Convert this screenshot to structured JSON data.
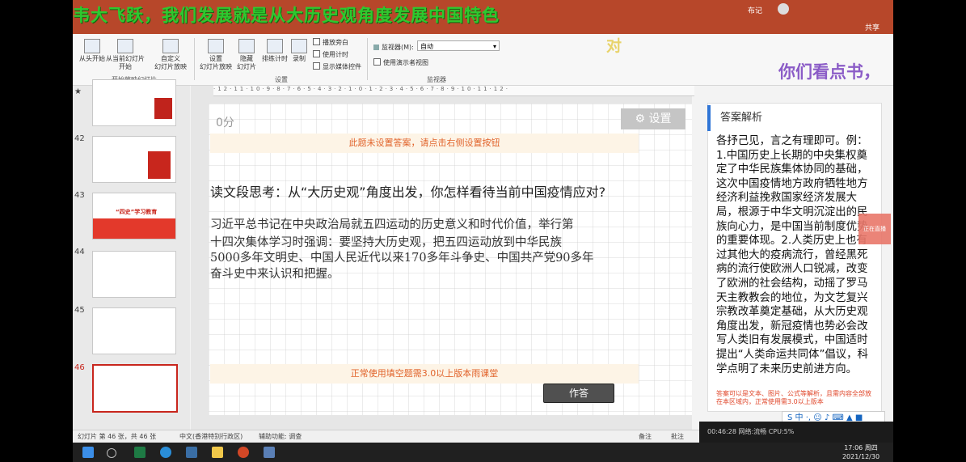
{
  "caption": {
    "main": "韦大飞跃，我们发展就是从大历史观角度发展中国特色",
    "dui": "对",
    "right": "你们看点书，"
  },
  "ribbon": {
    "buttons": {
      "from_start": "从头开始",
      "from_current": "从当前幻灯片\n开始",
      "custom": "自定义\n幻灯片放映",
      "setup": "设置\n幻灯片放映",
      "hide": "隐藏\n幻灯片",
      "rehearse": "排练计时",
      "record": "录制"
    },
    "checks": {
      "narration": "播放旁白",
      "timings": "使用计时",
      "media_controls": "显示媒体控件"
    },
    "monitor_label": "监视器(M):",
    "monitor_value": "自动",
    "presenter_view": "使用演示者视图",
    "groups": {
      "start": "开始放映幻灯片",
      "setup": "设置",
      "monitors": "监视器"
    },
    "share": "共享",
    "top_user": "布记"
  },
  "thumbnails": [
    {
      "num": "★",
      "title": ""
    },
    {
      "num": "42",
      "title": ""
    },
    {
      "num": "43",
      "title": "“四史”学习教育"
    },
    {
      "num": "44",
      "title": ""
    },
    {
      "num": "45",
      "title": ""
    },
    {
      "num": "46",
      "title": ""
    }
  ],
  "slide": {
    "score": "0分",
    "settings": "设置",
    "warning": "此题未设置答案，请点击右侧设置按钮",
    "question": "读文段思考：从“大历史观”角度出发，你怎样看待当前中国疫情应对?",
    "lines": [
      "习近平总书记在中央政治局就五四运动的历史意义和时代价值，举行第",
      "十四次集体学习时强调：要坚持大历史观，把五四运动放到中华民族",
      "5000多年文明史、中国人民近代以来170多年斗争史、中国共产党90多年",
      "奋斗史中来认识和把握。"
    ],
    "notice": "正常使用填空题需3.0以上版本雨课堂",
    "answer_button": "作答"
  },
  "pane": {
    "title": "答案解析",
    "body": "各抒己见，言之有理即可。例：1.中国历史上长期的中央集权奠定了中华民族集体协同的基础，这次中国疫情地方政府牺牲地方经济利益挽救国家经济发展大局，根源于中华文明沉淀出的民族向心力，是中国当前制度优势的重要体现。2.人类历史上也有过其他大的疫病流行，曾经黑死病的流行使欧洲人口锐减，改变了欧洲的社会结构，动摇了罗马天主教教会的地位，为文艺复兴宗教改革奠定基础，从大历史观角度出发，新冠疫情也势必会改写人类旧有发展模式，中国适时提出“人类命运共同体”倡议，科学点明了未来历史前进方向。",
    "footer": "答案可以是文本、图片、公式等解析，且需内容全部放在本区域内，正常使用需3.0以上版本",
    "live_tag": "正在直播"
  },
  "status": {
    "slide_pos": "幻灯片 第 46 张，共 46 张",
    "language": "中文(香港特别行政区)",
    "accessibility": "辅助功能: 调查",
    "notes": "备注",
    "comments": "批注",
    "live_time": "00:46:28 网络:流畅 CPU:5%"
  },
  "taskbar": {
    "time": "17:06 周四",
    "date": "2021/12/30"
  },
  "colors": {
    "ppt_red": "#b7472a",
    "caption_green": "#2fc82f",
    "warn_orange": "#e1632b",
    "pane_blue": "#2f75d6"
  }
}
